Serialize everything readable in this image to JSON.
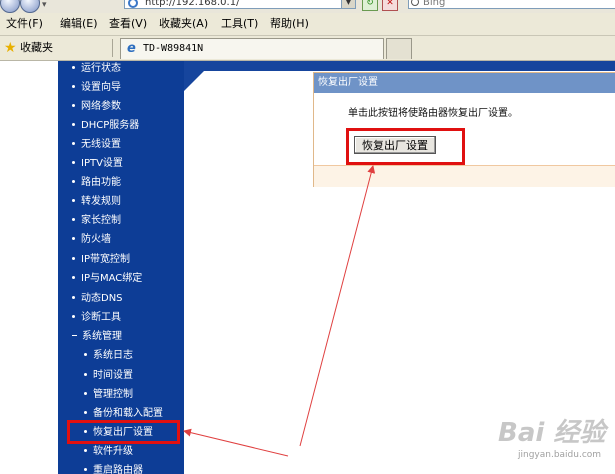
{
  "address_bar": {
    "url": "http://192.168.0.1/",
    "search_text": "Bing"
  },
  "menu": [
    "文件(F)",
    "编辑(E)",
    "查看(V)",
    "收藏夹(A)",
    "工具(T)",
    "帮助(H)"
  ],
  "favorites": {
    "label": "收藏夹",
    "tab_title": "TD-W89841N"
  },
  "sidebar": {
    "items": [
      "运行状态",
      "设置向导",
      "网络参数",
      "DHCP服务器",
      "无线设置",
      "IPTV设置",
      "路由功能",
      "转发规则",
      "家长控制",
      "防火墙",
      "IP带宽控制",
      "IP与MAC绑定",
      "动态DNS",
      "诊断工具",
      "系统管理"
    ],
    "subitems": [
      "系统日志",
      "时间设置",
      "管理控制",
      "备份和载入配置",
      "恢复出厂设置",
      "软件升级",
      "重启路由器"
    ]
  },
  "panel": {
    "title": "恢复出厂设置",
    "description": "单击此按钮将使路由器恢复出厂设置。",
    "button_label": "恢复出厂设置"
  },
  "colors": {
    "sidebar_bg": "#0d3d96",
    "panel_title_bg": "#6f93c7",
    "highlight": "#e01010",
    "arrow": "#e04040"
  },
  "watermark": {
    "brand": "Bai  经验",
    "url": "jingyan.baidu.com"
  }
}
